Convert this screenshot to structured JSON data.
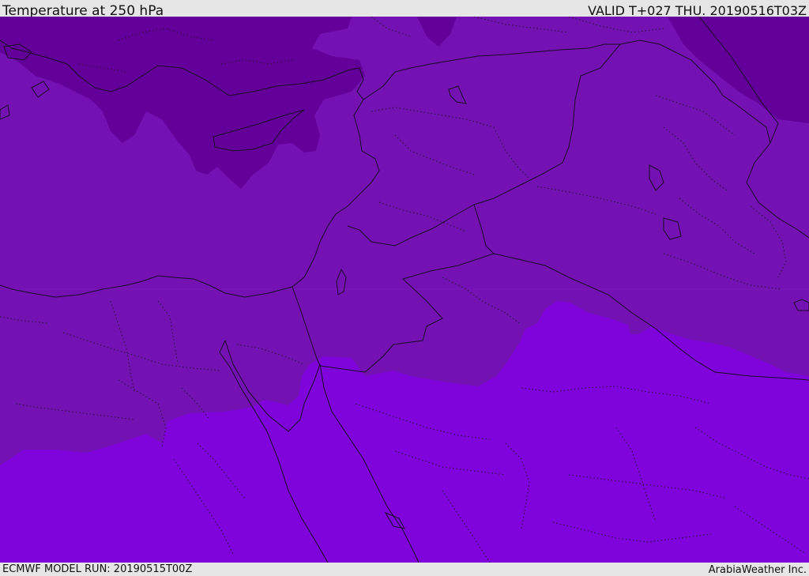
{
  "header": {
    "title": "Temperature at 250 hPa",
    "valid_time": "VALID T+027 THU. 20190516T03Z"
  },
  "footer": {
    "model_run": "ECMWF MODEL RUN: 20190515T00Z",
    "credit": "ArabiaWeather Inc."
  },
  "map": {
    "field": "temperature-250hpa",
    "colors": {
      "coldest": "#630099",
      "middle": "#7411b3",
      "warm": "#7f04db"
    }
  }
}
